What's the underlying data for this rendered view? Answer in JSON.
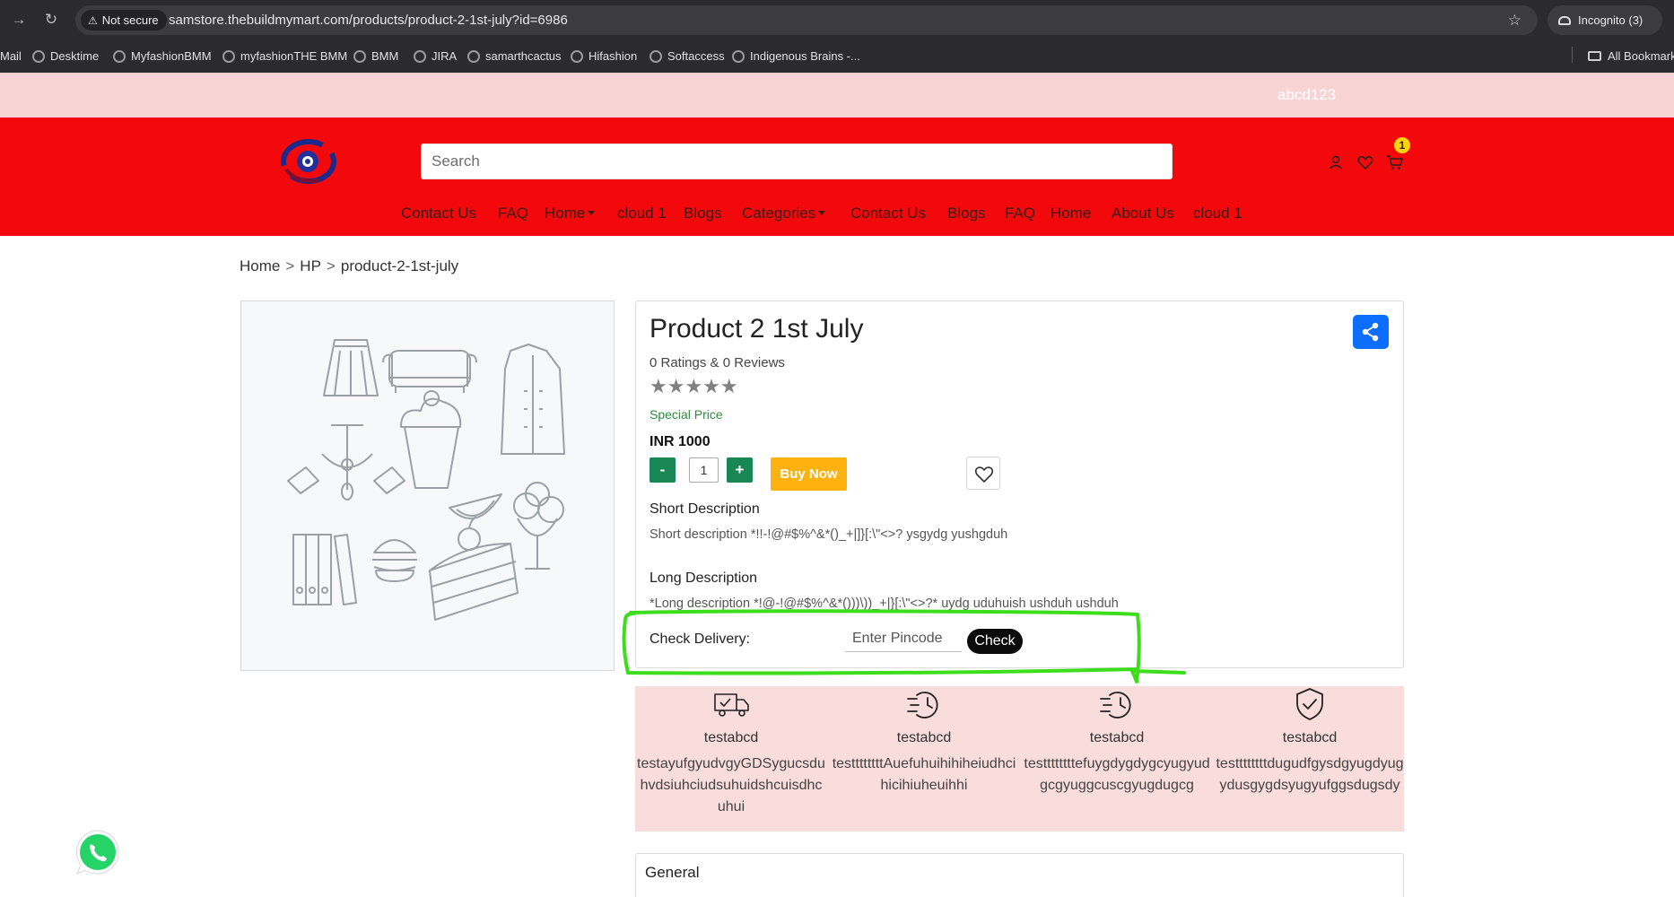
{
  "browser": {
    "security_label": "Not secure",
    "url": "samstore.thebuildmymart.com/products/product-2-1st-july?id=6986",
    "incognito_label": "Incognito (3)",
    "bookmarks": [
      "Mail",
      "Desktime",
      "MyfashionBMM",
      "myfashionTHE BMM",
      "BMM",
      "JIRA",
      "samarthcactus",
      "Hifashion",
      "Softaccess",
      "Indigenous Brains -..."
    ],
    "all_bookmarks_label": "All Bookmarks"
  },
  "promo_bar": {
    "text": "abcd123"
  },
  "header": {
    "search_placeholder": "Search",
    "cart_count": "1",
    "menu": [
      "Contact Us",
      "FAQ",
      "Home",
      "cloud 1",
      "Blogs",
      "Categories",
      "Contact Us",
      "Blogs",
      "FAQ",
      "Home",
      "About Us",
      "cloud 1"
    ]
  },
  "breadcrumb": {
    "items": [
      "Home",
      "HP",
      "product-2-1st-july"
    ],
    "separator": ">"
  },
  "product": {
    "title": "Product 2 1st July",
    "ratings_text": "0 Ratings & 0 Reviews",
    "stars": "★★★★★",
    "rating_value": 0,
    "special_price_label": "Special Price",
    "price": "INR 1000",
    "quantity": "1",
    "minus_label": "-",
    "plus_label": "+",
    "buy_now_label": "Buy Now",
    "short_description_heading": "Short Description",
    "short_description": "Short description *!!-!@#$%^&*()_+|]}[:\\\"<>? ysgydg yushgduh",
    "long_description_heading": "Long Description",
    "long_description": "*Long description *!@-!@#$%^&*()))\\))_+|}[:\\\"<>?* uydg uduhuish ushduh ushduh",
    "check_delivery_label": "Check Delivery:",
    "pincode_placeholder": "Enter Pincode",
    "check_label": "Check"
  },
  "features": [
    {
      "icon": "delivery-truck-icon",
      "title": "testabcd",
      "desc": "testayufgyudvgyGDSygucsduhvdsiuhciudsuhuidshcuisdhcuhui"
    },
    {
      "icon": "fast-clock-icon",
      "title": "testabcd",
      "desc": "testtttttttAuefuhuihihiheiudhcihicihiuheuihhi"
    },
    {
      "icon": "fast-clock-icon",
      "title": "testabcd",
      "desc": "testtttttttefuygdygdygcyugyudgcgyuggcuscgyugdugcg"
    },
    {
      "icon": "shield-check-icon",
      "title": "testabcd",
      "desc": "testtttttttdugudfgysdgyugdyugydusgygdsyugyufggsdugsdy"
    }
  ],
  "general": {
    "heading": "General"
  },
  "colors": {
    "header_red": "#f3090b",
    "promo_pink": "#f9d4d4",
    "feature_pink": "#f9dcdc",
    "share_blue": "#0d6efd",
    "qty_green": "#198754",
    "buy_yellow": "#ffb20f",
    "annotation_green": "#3cde1c"
  }
}
